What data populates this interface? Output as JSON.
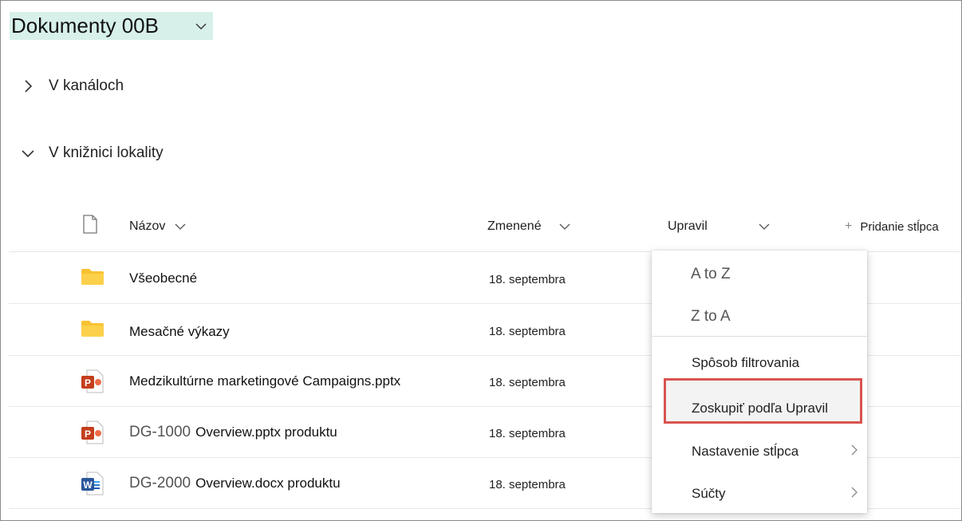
{
  "library": {
    "title": "Dokumenty 00B"
  },
  "sections": [
    {
      "label": "V kanáloch",
      "expanded": false
    },
    {
      "label": "V knižnici lokality",
      "expanded": true
    }
  ],
  "columns": {
    "name": "Názov",
    "modified": "Zmenené",
    "modified_by": "Upravil",
    "add_column": "Pridanie stĺpca"
  },
  "rows": [
    {
      "type": "folder",
      "id": "",
      "name": "Všeobecné",
      "date": "18. septembra"
    },
    {
      "type": "folder",
      "id": "",
      "name": "Mesačné výkazy",
      "date": "18. septembra"
    },
    {
      "type": "pptx",
      "id": "",
      "name": "Medzikultúrne marketingové Campaigns.pptx",
      "date": "18. septembra"
    },
    {
      "type": "pptx",
      "id": "DG-1000",
      "name": "Overview.pptx produktu",
      "date": "18. septembra"
    },
    {
      "type": "docx",
      "id": "DG-2000",
      "name": "Overview.docx produktu",
      "date": "18. septembra"
    }
  ],
  "menu": {
    "sort_az": "A to Z",
    "sort_za": "Z to A",
    "filter_by": "Spôsob filtrovania",
    "group_by": "Zoskupiť podľa Upravil",
    "column_settings": "Nastavenie stĺpca",
    "totals": "Súčty"
  },
  "colors": {
    "highlight_bg": "#d7f0ea",
    "callout_border": "#d9534f",
    "folder": "#f8c232",
    "ppt": "#c43e1c",
    "word": "#2b579a"
  }
}
